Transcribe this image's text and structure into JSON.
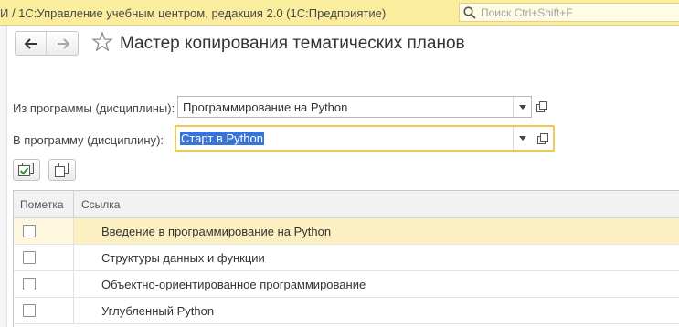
{
  "window": {
    "title": "И / 1С:Управление учебным центром, редакция 2.0  (1С:Предприятие)",
    "search_placeholder": "Поиск Ctrl+Shift+F"
  },
  "form": {
    "title": "Мастер копирования тематических планов"
  },
  "fields": {
    "from_label": "Из программы (дисциплины):",
    "from_value": "Программирование на Python",
    "to_label": "В программу (дисциплину):",
    "to_value": "Старт в Python"
  },
  "table": {
    "columns": [
      "Пометка",
      "Ссылка"
    ],
    "rows": [
      {
        "checked": false,
        "text": "Введение в программирование на Python",
        "selected": true
      },
      {
        "checked": false,
        "text": "Структуры данных и функции",
        "selected": false
      },
      {
        "checked": false,
        "text": "Объектно-ориентированное программирование",
        "selected": false
      },
      {
        "checked": false,
        "text": "Углубленный Python",
        "selected": false
      }
    ]
  },
  "icons": {
    "back": "arrow-left-icon",
    "forward": "arrow-right-icon",
    "favorite": "star-icon",
    "search": "search-icon",
    "dropdown": "dropdown-arrow-icon",
    "open": "open-window-icon",
    "check_all": "check-all-icon",
    "copy": "copy-icon"
  },
  "colors": {
    "titlebar": "#fbed9e",
    "focus_border": "#f0c75a",
    "selection": "#3874d8",
    "selected_row": "#fcf0c2"
  }
}
